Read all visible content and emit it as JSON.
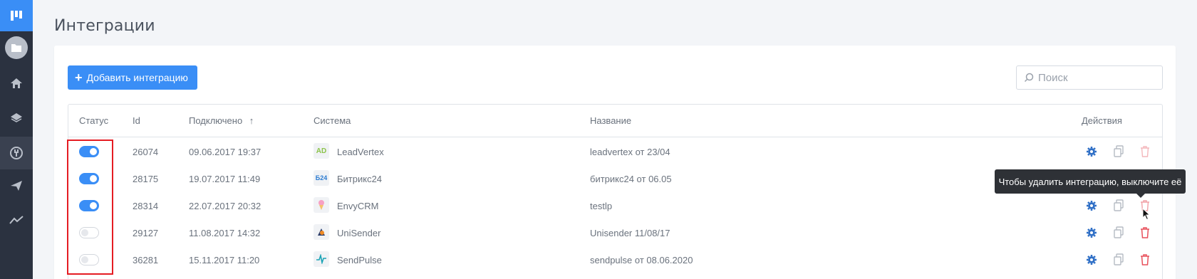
{
  "page": {
    "title": "Интеграции",
    "add_button_label": "Добавить интеграцию",
    "search_placeholder": "Поиск"
  },
  "colors": {
    "accent": "#3a8ef6",
    "sidebar": "#2b3240",
    "danger": "#e8505b",
    "highlight": "#e51c23"
  },
  "sidebar": {
    "items": [
      {
        "icon": "folder-icon"
      },
      {
        "icon": "home-icon"
      },
      {
        "icon": "layers-icon"
      },
      {
        "icon": "integrations-icon"
      },
      {
        "icon": "send-icon"
      },
      {
        "icon": "chart-icon"
      }
    ]
  },
  "table": {
    "headers": {
      "status": "Статус",
      "id": "Id",
      "connected": "Подключено",
      "sort_arrow": "↑",
      "system": "Система",
      "name": "Название",
      "actions": "Действия"
    },
    "rows": [
      {
        "enabled": true,
        "id": "26074",
        "connected": "09.06.2017 19:37",
        "system": "LeadVertex",
        "system_badge": "AD",
        "name": "leadvertex от 23/04"
      },
      {
        "enabled": true,
        "id": "28175",
        "connected": "19.07.2017 11:49",
        "system": "Битрикс24",
        "system_badge": "Б24",
        "name": "битрикс24 от 06.05"
      },
      {
        "enabled": true,
        "id": "28314",
        "connected": "22.07.2017 20:32",
        "system": "EnvyCRM",
        "system_badge": "",
        "name": "testlp"
      },
      {
        "enabled": false,
        "id": "29127",
        "connected": "11.08.2017 14:32",
        "system": "UniSender",
        "system_badge": "",
        "name": "Unisender 11/08/17"
      },
      {
        "enabled": false,
        "id": "36281",
        "connected": "15.11.2017 11:20",
        "system": "SendPulse",
        "system_badge": "",
        "name": "sendpulse от 08.06.2020"
      }
    ]
  },
  "tooltip": {
    "text": "Чтобы удалить интеграцию, выключите её"
  }
}
